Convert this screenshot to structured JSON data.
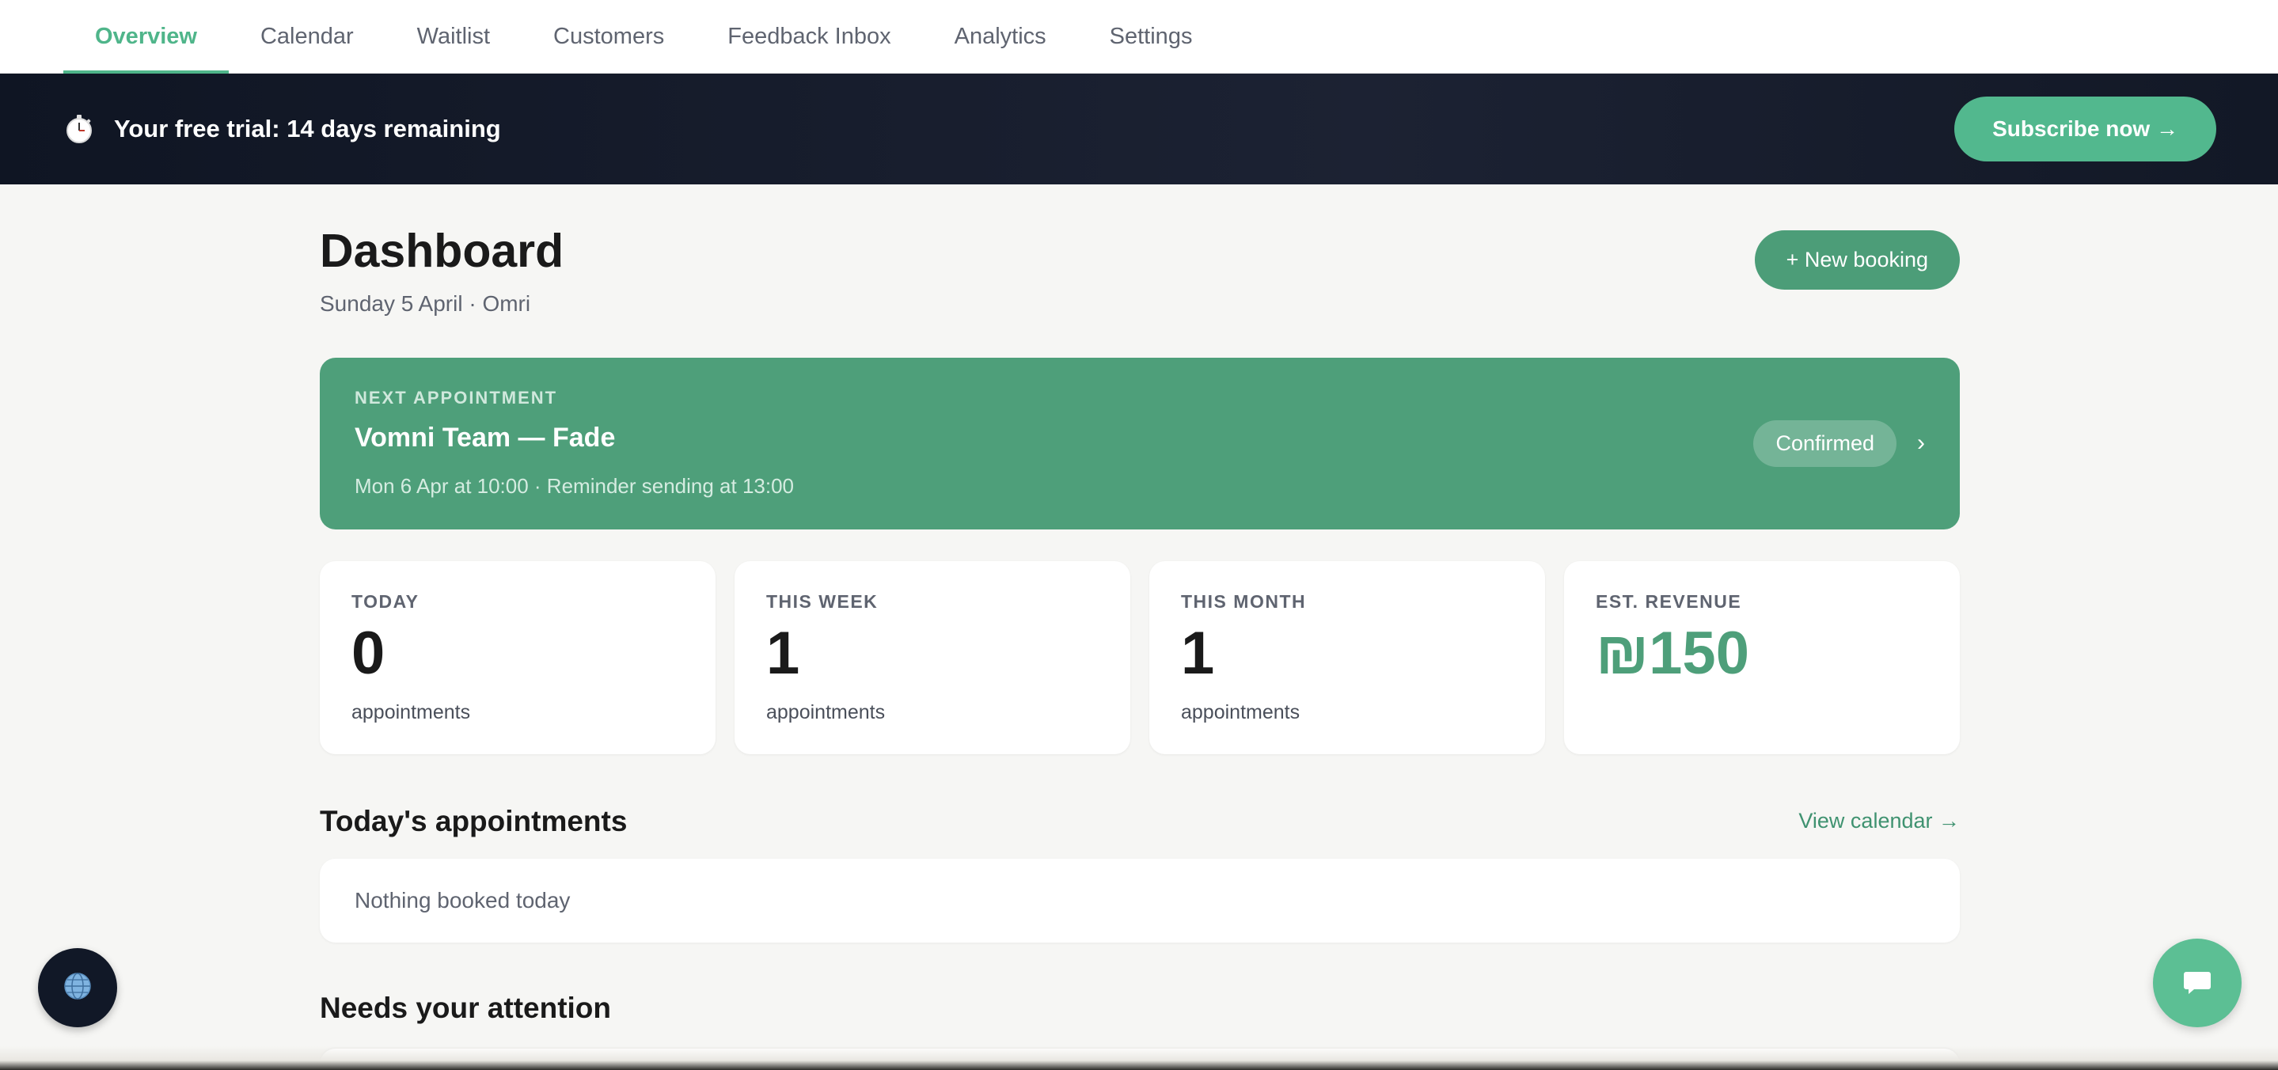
{
  "nav": {
    "tabs": [
      {
        "label": "Overview",
        "active": true
      },
      {
        "label": "Calendar"
      },
      {
        "label": "Waitlist"
      },
      {
        "label": "Customers"
      },
      {
        "label": "Feedback Inbox"
      },
      {
        "label": "Analytics"
      },
      {
        "label": "Settings"
      }
    ]
  },
  "trial": {
    "icon": "stopwatch-icon",
    "text": "Your free trial: 14 days remaining",
    "cta": "Subscribe now →"
  },
  "header": {
    "title": "Dashboard",
    "subtitle": "Sunday 5 April · Omri",
    "new_booking": "+ New booking"
  },
  "next_appointment": {
    "label": "NEXT APPOINTMENT",
    "title": "Vomni Team — Fade",
    "detail": "Mon 6 Apr at 10:00 · Reminder sending at 13:00",
    "status": "Confirmed",
    "chevron": "›"
  },
  "stats": [
    {
      "label": "TODAY",
      "value": "0",
      "unit": "appointments"
    },
    {
      "label": "THIS WEEK",
      "value": "1",
      "unit": "appointments"
    },
    {
      "label": "THIS MONTH",
      "value": "1",
      "unit": "appointments"
    },
    {
      "label": "EST. REVENUE",
      "value": "₪150"
    }
  ],
  "today": {
    "title": "Today's appointments",
    "link": "View calendar →",
    "empty": "Nothing booked today"
  },
  "attention": {
    "title": "Needs your attention"
  },
  "colors": {
    "accent": "#4fb58a",
    "card_green": "#4e9f7a",
    "banner_dark": "#0f1523"
  },
  "floating": {
    "globe_icon": "globe-icon",
    "chat_icon": "chat-icon"
  }
}
